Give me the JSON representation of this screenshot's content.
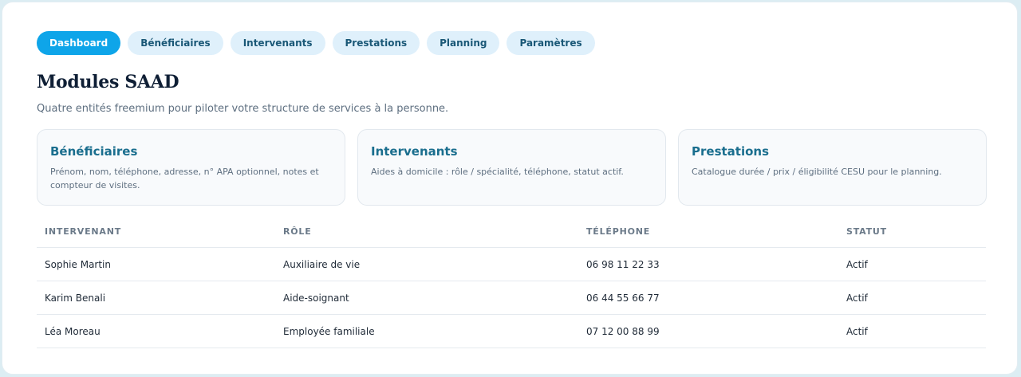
{
  "nav": {
    "tabs": [
      {
        "label": "Dashboard"
      },
      {
        "label": "Bénéficiaires"
      },
      {
        "label": "Intervenants"
      },
      {
        "label": "Prestations"
      },
      {
        "label": "Planning"
      },
      {
        "label": "Paramètres"
      }
    ],
    "active": "Dashboard"
  },
  "page": {
    "title": "Modules SAAD",
    "subtitle": "Quatre entités freemium pour piloter votre structure de services à la personne."
  },
  "cards": [
    {
      "title": "Bénéficiaires",
      "description": "Prénom, nom, téléphone, adresse, n° APA optionnel, notes et compteur de visites."
    },
    {
      "title": "Intervenants",
      "description": "Aides à domicile : rôle / spécialité, téléphone, statut actif."
    },
    {
      "title": "Prestations",
      "description": "Catalogue durée / prix / éligibilité CESU pour le planning."
    }
  ],
  "table": {
    "headers": [
      "INTERVENANT",
      "RÔLE",
      "TÉLÉPHONE",
      "STATUT"
    ],
    "rows": [
      [
        "Sophie Martin",
        "Auxiliaire de vie",
        "06 98 11 22 33",
        "Actif"
      ],
      [
        "Karim Benali",
        "Aide-soignant",
        "06 44 55 66 77",
        "Actif"
      ],
      [
        "Léa Moreau",
        "Employée familiale",
        "07 12 00 88 99",
        "Actif"
      ]
    ]
  },
  "colors": {
    "accent": "#0ea5e9",
    "tab_background": "#dff0fb",
    "card_title": "#1a6e8e"
  }
}
